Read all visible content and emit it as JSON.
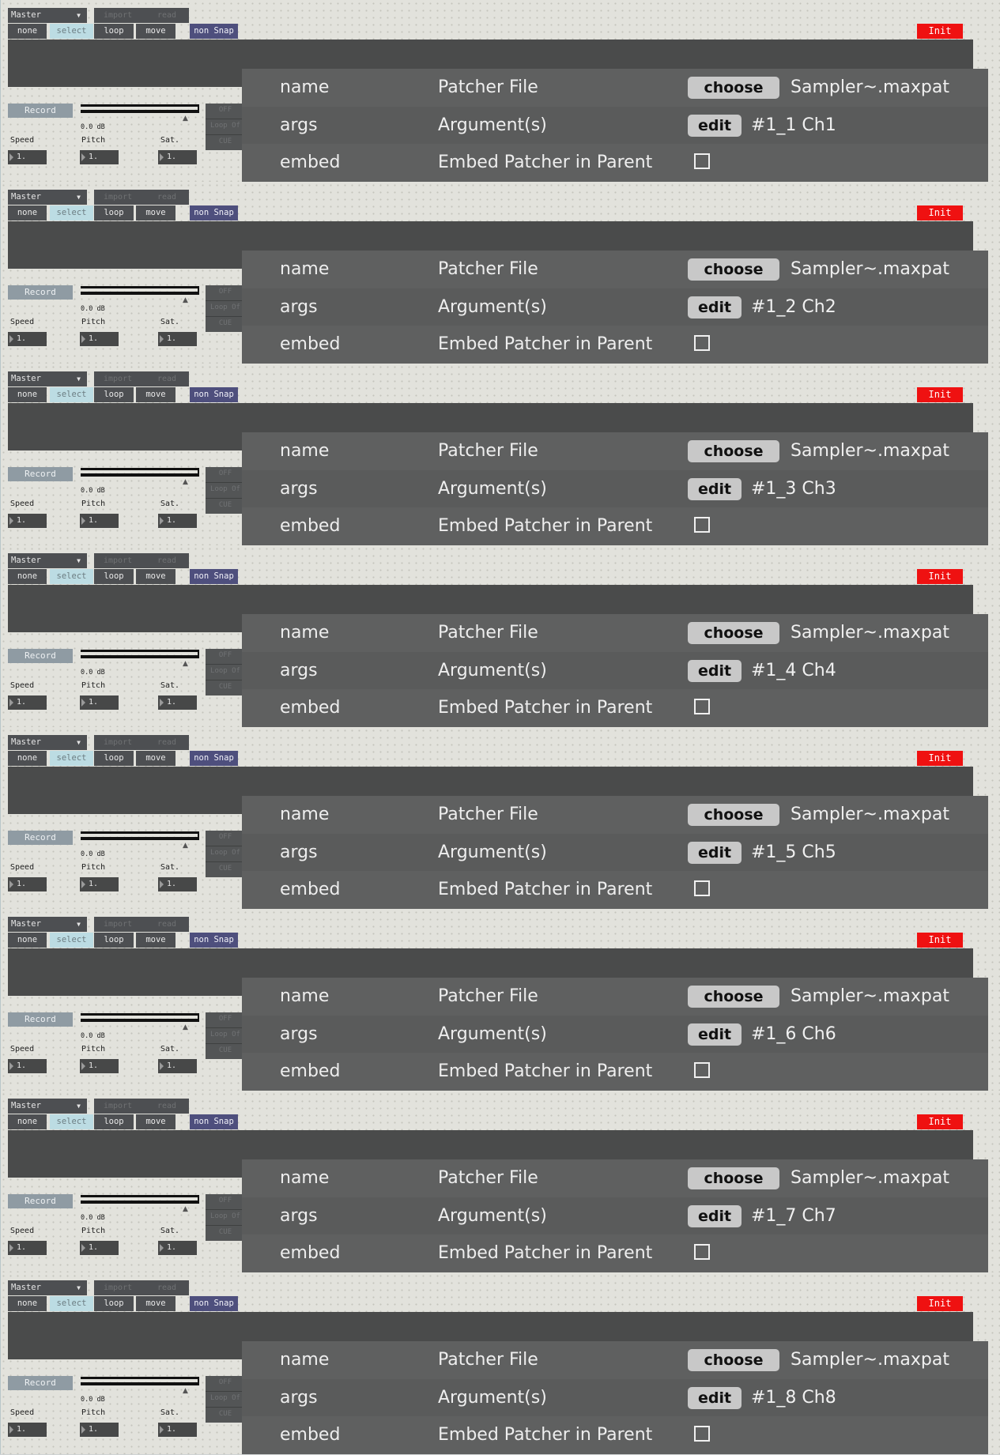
{
  "top_controls": {
    "master_label": "Master",
    "import_label": "import",
    "read_label": "read",
    "none_label": "none",
    "select_label": "select",
    "loop_label": "loop",
    "move_label": "move",
    "snap_label": "non Snap",
    "init_label": "Init"
  },
  "transport": {
    "record_label": "Record",
    "db_readout": "0.0 dB",
    "speed_label": "Speed",
    "pitch_label": "Pitch",
    "sat_label": "Sat.",
    "speed_value": "1.",
    "pitch_value": "1.",
    "sat_value": "1.",
    "off_label": "OFF",
    "loop_label": "Loop Of",
    "cue_label": "CUE"
  },
  "inspector": {
    "name_key": "name",
    "name_desc": "Patcher File",
    "choose_label": "choose",
    "file_value": "Sampler~.maxpat",
    "args_key": "args",
    "args_desc": "Argument(s)",
    "edit_label": "edit",
    "embed_key": "embed",
    "embed_desc": "Embed Patcher in Parent",
    "embed_checked": false
  },
  "channels": [
    {
      "args_value": "#1_1 Ch1"
    },
    {
      "args_value": "#1_2 Ch2"
    },
    {
      "args_value": "#1_3 Ch3"
    },
    {
      "args_value": "#1_4 Ch4"
    },
    {
      "args_value": "#1_5 Ch5"
    },
    {
      "args_value": "#1_6 Ch6"
    },
    {
      "args_value": "#1_7 Ch7"
    },
    {
      "args_value": "#1_8 Ch8"
    }
  ]
}
